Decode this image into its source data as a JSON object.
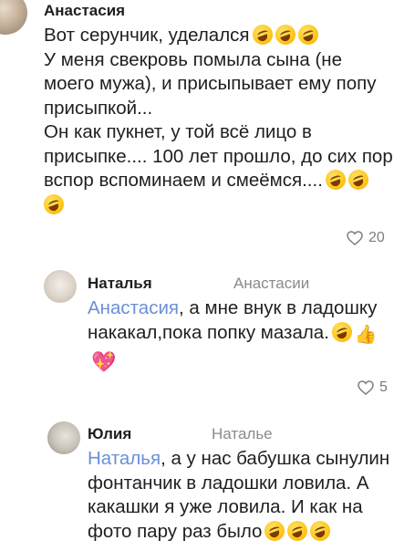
{
  "comments": [
    {
      "author": "Анастасия",
      "lines": [
        "Вот серунчик, уделался",
        "У меня свекровь помыла сына (не",
        "моего мужа), и присыпывает ему попу",
        "присыпкой...",
        "Он как пукнет, у той всё лицо в",
        "присыпке.... 100 лет прошло, до сих пор",
        "вспор вспоминаем и смеёмся...."
      ],
      "likes": "20"
    },
    {
      "author": "Наталья",
      "reply_to": "Анастасии",
      "mention": "Анастасия",
      "line1_rest": ", а мне внук в ладошку",
      "line2": "накакал,пока попку мазала.",
      "likes": "5"
    },
    {
      "author": "Юлия",
      "reply_to": "Наталье",
      "mention": "Наталья",
      "line1_rest": ", а у нас бабушка сынулин",
      "line2": "фонтанчик в ладошки ловила. А",
      "line3": "какашки я уже ловила. И как на",
      "line4": "фото пару раз было"
    }
  ],
  "icons": {
    "emoji": "rolling-on-floor-laughing",
    "thumb": "thumbs-up",
    "heart": "sparkling-heart",
    "like": "heart-outline"
  },
  "colors": {
    "mention": "#6b8fd6",
    "secondary": "#8a8a8a",
    "text": "#1f1f1f"
  }
}
